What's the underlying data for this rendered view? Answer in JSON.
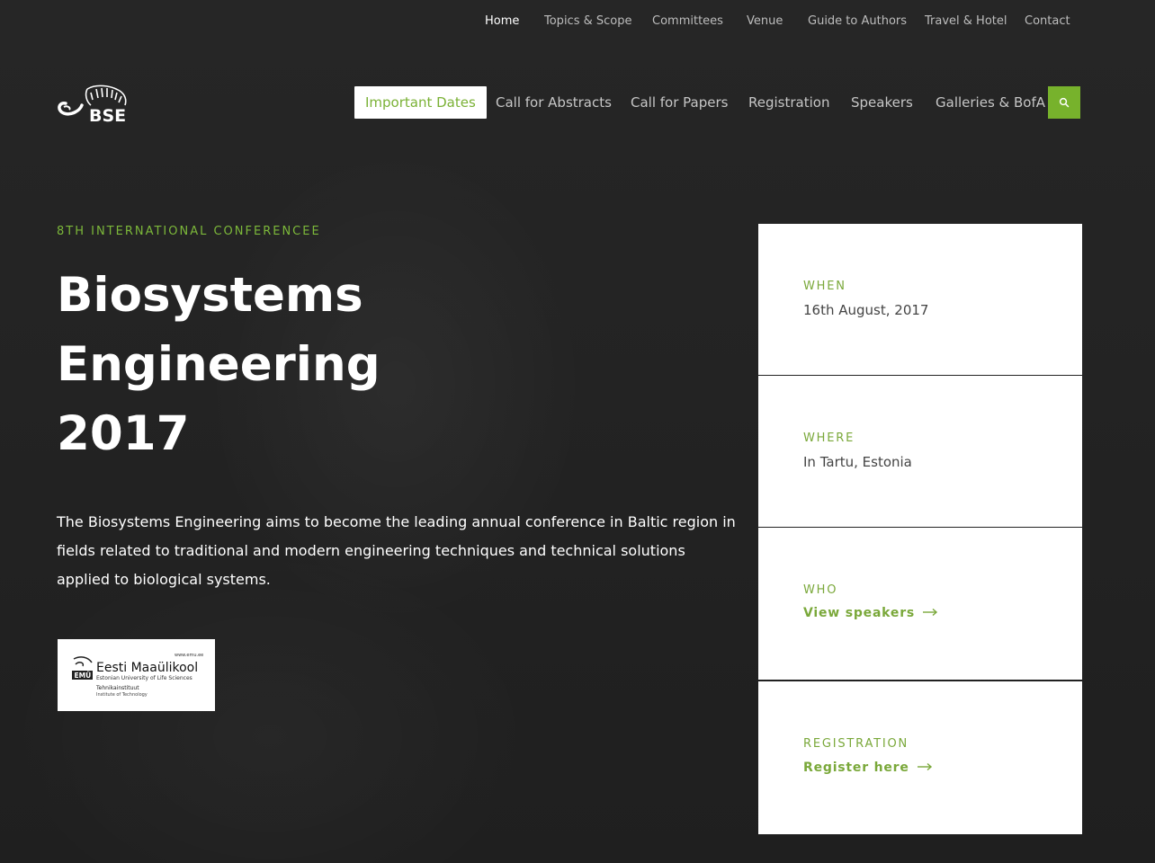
{
  "top_nav": [
    {
      "label": "Home"
    },
    {
      "label": "Topics & Scope"
    },
    {
      "label": "Committees"
    },
    {
      "label": "Venue"
    },
    {
      "label": "Guide to Authors"
    },
    {
      "label": "Travel & Hotel"
    },
    {
      "label": "Contact"
    }
  ],
  "logo": {
    "text": "BSE"
  },
  "main_nav": [
    {
      "label": "Important Dates"
    },
    {
      "label": "Call for Abstracts"
    },
    {
      "label": "Call for Papers"
    },
    {
      "label": "Registration"
    },
    {
      "label": "Speakers"
    },
    {
      "label": "Galleries & BofA"
    }
  ],
  "icons": {
    "search": "search-icon",
    "arrow": "arrow-right-icon"
  },
  "hero": {
    "eyebrow": "8TH INTERNATIONAL CONFERENCEE",
    "title_lines": [
      "Biosystems",
      "Engineering",
      "2017"
    ],
    "description": "The Biosystems Engineering aims to become the leading annual conference in Baltic region in fields related to traditional and modern engineering techniques and technical solutions applied to biological systems."
  },
  "sponsor": {
    "site": "www.emu.ee",
    "name": "Eesti Maaülikool",
    "subtitle": "Estonian University of Life Sciences",
    "institute_et": "Tehnikainstituut",
    "institute_en": "Institute of Technology",
    "abbr": "EMÜ"
  },
  "info": {
    "when": {
      "label": "WHEN",
      "value": "16th August, 2017"
    },
    "where": {
      "label": "WHERE",
      "value": "In Tartu, Estonia"
    },
    "who": {
      "label": "WHO",
      "link": "View speakers"
    },
    "registration": {
      "label": "REGISTRATION",
      "link": "Register here"
    }
  },
  "colors": {
    "accent": "#77b22c",
    "background": "#232323"
  }
}
